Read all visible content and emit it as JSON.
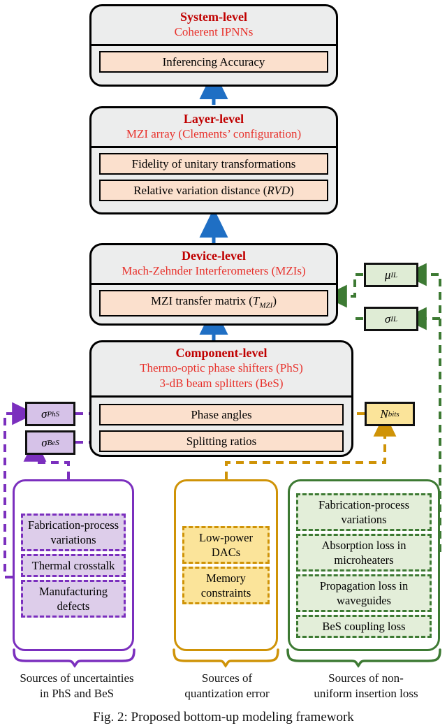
{
  "colors": {
    "title_red": "#c00000",
    "subtitle_red": "#e8322c",
    "card_fill": "#eceded",
    "metric_fill": "#fbe0cd",
    "purple": "#7b2fbe",
    "purple_fill": "#ddcdea",
    "orange": "#cf9307",
    "orange_fill": "#fbe49a",
    "green": "#3d7a33",
    "green_fill": "#e3eed9",
    "arrow_blue": "#1f6fc4"
  },
  "levels": {
    "system": {
      "title": "System-level",
      "subtitle": "Coherent IPNNs",
      "metrics": [
        "Inferencing Accuracy"
      ]
    },
    "layer": {
      "title": "Layer-level",
      "subtitle": "MZI array (Clements’ configuration)",
      "metrics": [
        "Fidelity of unitary transformations",
        "Relative variation distance (RVD)"
      ],
      "metric_italics": [
        "",
        "RVD"
      ]
    },
    "device": {
      "title": "Device-level",
      "subtitle": "Mach-Zehnder Interferometers (MZIs)",
      "metrics": [
        "MZI transfer matrix (TMZI)"
      ],
      "metric_italics": [
        "TMZI"
      ]
    },
    "component": {
      "title": "Component-level",
      "subtitle_1": "Thermo-optic phase shifters (PhS)",
      "subtitle_2": "3-dB beam splitters (BeS)",
      "metrics": [
        "Phase angles",
        "Splitting ratios"
      ]
    }
  },
  "chips": {
    "sigma_phs": {
      "symbol": "σ",
      "sub": "PhS"
    },
    "sigma_bes": {
      "symbol": "σ",
      "sub": "BeS"
    },
    "mu_il": {
      "symbol": "μ",
      "sub": "IL"
    },
    "sigma_il": {
      "symbol": "σ",
      "sub": "IL"
    },
    "n_bits": {
      "symbol": "N",
      "sub": "bits"
    }
  },
  "sources": {
    "uncertainty": {
      "items": [
        "Fabrication-process variations",
        "Thermal crosstalk",
        "Manufacturing defects"
      ],
      "caption_line_1": "Sources of uncertainties",
      "caption_line_2": "in PhS and BeS"
    },
    "quantization": {
      "items": [
        "Low-power DACs",
        "Memory constraints"
      ],
      "caption_line_1": "Sources of",
      "caption_line_2": "quantization error"
    },
    "insertion_loss": {
      "items": [
        "Fabrication-process variations",
        "Absorption loss in microheaters",
        "Propagation loss in waveguides",
        "BeS coupling loss"
      ],
      "caption_line_1": "Sources of non-",
      "caption_line_2": "uniform insertion loss"
    }
  },
  "figure_caption": "Fig. 2: Proposed bottom-up modeling framework"
}
